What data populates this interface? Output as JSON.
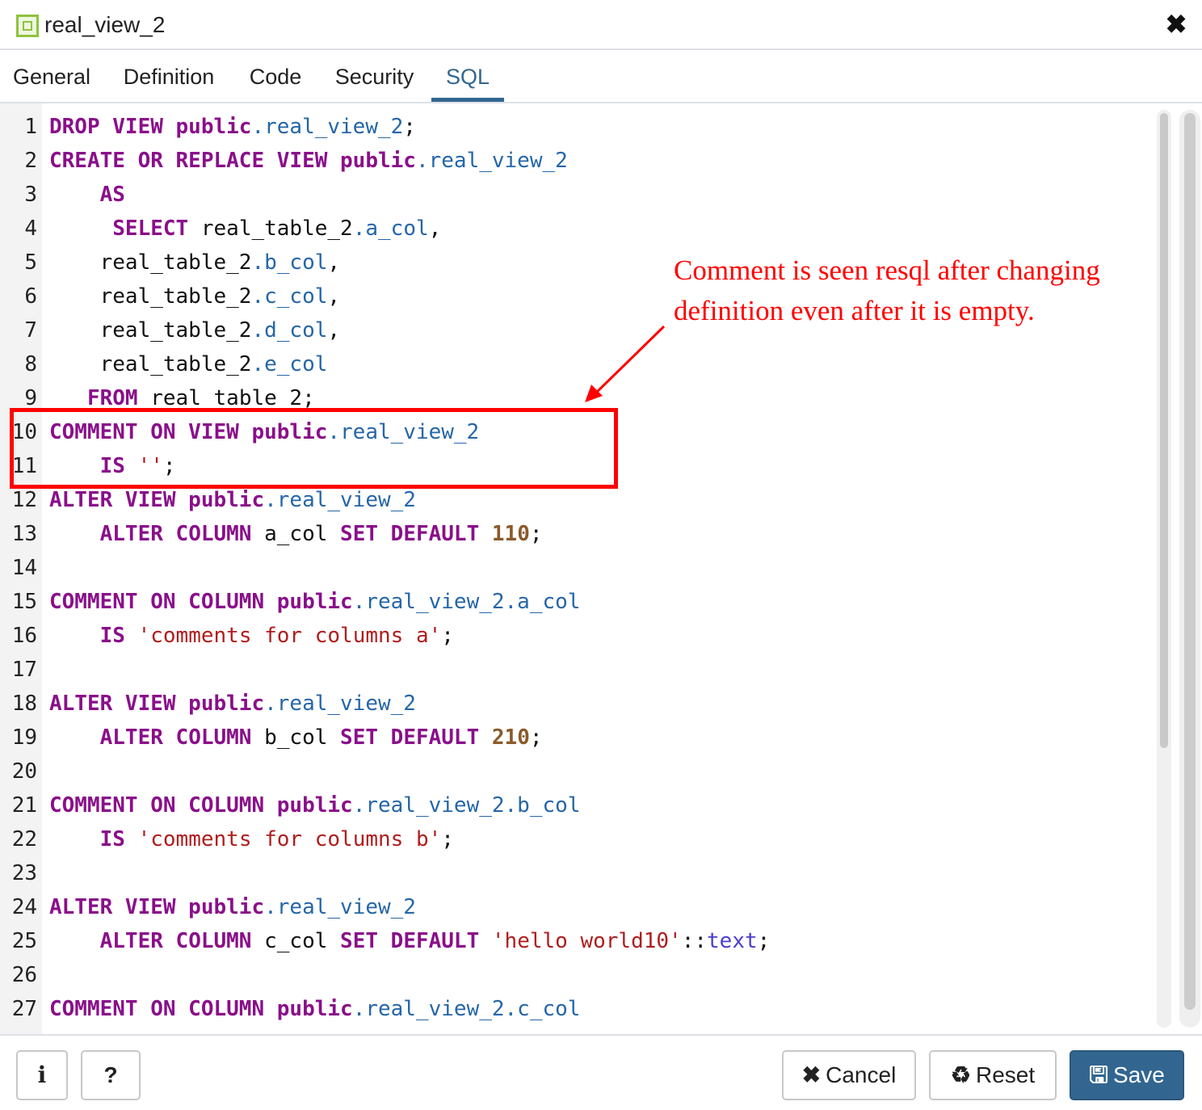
{
  "dialog": {
    "title": "real_view_2",
    "icon": "view-icon",
    "close_glyph": "✖"
  },
  "tabs": [
    {
      "label": "General",
      "active": false
    },
    {
      "label": "Definition",
      "active": false
    },
    {
      "label": "Code",
      "active": false
    },
    {
      "label": "Security",
      "active": false
    },
    {
      "label": "SQL",
      "active": true
    }
  ],
  "sql_lines": [
    {
      "n": "1",
      "tokens": [
        [
          "kw",
          "DROP VIEW public"
        ],
        [
          "id",
          ".real_view_2"
        ],
        [
          "p",
          ";"
        ]
      ]
    },
    {
      "n": "2",
      "tokens": [
        [
          "kw",
          "CREATE OR REPLACE VIEW public"
        ],
        [
          "id",
          ".real_view_2"
        ]
      ]
    },
    {
      "n": "3",
      "tokens": [
        [
          "p",
          "    "
        ],
        [
          "kw",
          "AS"
        ]
      ]
    },
    {
      "n": "4",
      "tokens": [
        [
          "p",
          "     "
        ],
        [
          "kw",
          "SELECT"
        ],
        [
          "p",
          " real_table_2"
        ],
        [
          "id",
          ".a_col"
        ],
        [
          "p",
          ","
        ]
      ]
    },
    {
      "n": "5",
      "tokens": [
        [
          "p",
          "    real_table_2"
        ],
        [
          "id",
          ".b_col"
        ],
        [
          "p",
          ","
        ]
      ]
    },
    {
      "n": "6",
      "tokens": [
        [
          "p",
          "    real_table_2"
        ],
        [
          "id",
          ".c_col"
        ],
        [
          "p",
          ","
        ]
      ]
    },
    {
      "n": "7",
      "tokens": [
        [
          "p",
          "    real_table_2"
        ],
        [
          "id",
          ".d_col"
        ],
        [
          "p",
          ","
        ]
      ]
    },
    {
      "n": "8",
      "tokens": [
        [
          "p",
          "    real_table_2"
        ],
        [
          "id",
          ".e_col"
        ]
      ]
    },
    {
      "n": "9",
      "tokens": [
        [
          "p",
          "   "
        ],
        [
          "kw",
          "FROM"
        ],
        [
          "p",
          " real_table_2;"
        ]
      ]
    },
    {
      "n": "10",
      "tokens": [
        [
          "kw",
          "COMMENT ON VIEW public"
        ],
        [
          "id",
          ".real_view_2"
        ]
      ]
    },
    {
      "n": "11",
      "tokens": [
        [
          "p",
          "    "
        ],
        [
          "kw",
          "IS"
        ],
        [
          "p",
          " "
        ],
        [
          "str",
          "''"
        ],
        [
          "p",
          ";"
        ]
      ]
    },
    {
      "n": "12",
      "tokens": [
        [
          "kw",
          "ALTER VIEW public"
        ],
        [
          "id",
          ".real_view_2"
        ]
      ]
    },
    {
      "n": "13",
      "tokens": [
        [
          "p",
          "    "
        ],
        [
          "kw",
          "ALTER COLUMN"
        ],
        [
          "p",
          " a_col "
        ],
        [
          "kw",
          "SET DEFAULT"
        ],
        [
          "p",
          " "
        ],
        [
          "num",
          "110"
        ],
        [
          "p",
          ";"
        ]
      ]
    },
    {
      "n": "14",
      "tokens": []
    },
    {
      "n": "15",
      "tokens": [
        [
          "kw",
          "COMMENT ON COLUMN public"
        ],
        [
          "id",
          ".real_view_2.a_col"
        ]
      ]
    },
    {
      "n": "16",
      "tokens": [
        [
          "p",
          "    "
        ],
        [
          "kw",
          "IS"
        ],
        [
          "p",
          " "
        ],
        [
          "str",
          "'comments for columns a'"
        ],
        [
          "p",
          ";"
        ]
      ]
    },
    {
      "n": "17",
      "tokens": []
    },
    {
      "n": "18",
      "tokens": [
        [
          "kw",
          "ALTER VIEW public"
        ],
        [
          "id",
          ".real_view_2"
        ]
      ]
    },
    {
      "n": "19",
      "tokens": [
        [
          "p",
          "    "
        ],
        [
          "kw",
          "ALTER COLUMN"
        ],
        [
          "p",
          " b_col "
        ],
        [
          "kw",
          "SET DEFAULT"
        ],
        [
          "p",
          " "
        ],
        [
          "num",
          "210"
        ],
        [
          "p",
          ";"
        ]
      ]
    },
    {
      "n": "20",
      "tokens": []
    },
    {
      "n": "21",
      "tokens": [
        [
          "kw",
          "COMMENT ON COLUMN public"
        ],
        [
          "id",
          ".real_view_2.b_col"
        ]
      ]
    },
    {
      "n": "22",
      "tokens": [
        [
          "p",
          "    "
        ],
        [
          "kw",
          "IS"
        ],
        [
          "p",
          " "
        ],
        [
          "str",
          "'comments for columns b'"
        ],
        [
          "p",
          ";"
        ]
      ]
    },
    {
      "n": "23",
      "tokens": []
    },
    {
      "n": "24",
      "tokens": [
        [
          "kw",
          "ALTER VIEW public"
        ],
        [
          "id",
          ".real_view_2"
        ]
      ]
    },
    {
      "n": "25",
      "tokens": [
        [
          "p",
          "    "
        ],
        [
          "kw",
          "ALTER COLUMN"
        ],
        [
          "p",
          " c_col "
        ],
        [
          "kw",
          "SET DEFAULT"
        ],
        [
          "p",
          " "
        ],
        [
          "str",
          "'hello world10'"
        ],
        [
          "p",
          "::"
        ],
        [
          "typ",
          "text"
        ],
        [
          "p",
          ";"
        ]
      ]
    },
    {
      "n": "26",
      "tokens": []
    },
    {
      "n": "27",
      "tokens": [
        [
          "kw",
          "COMMENT ON COLUMN public"
        ],
        [
          "id",
          ".real_view_2.c_col"
        ]
      ]
    }
  ],
  "annotation": {
    "text": "Comment is seen resql after changing definition even after it is empty.",
    "color": "#ff0000"
  },
  "footer": {
    "info_label": "i",
    "help_label": "?",
    "cancel_label": "Cancel",
    "reset_label": "Reset",
    "save_label": "Save"
  },
  "colors": {
    "keyword": "#8a0f8a",
    "identifier": "#2566a8",
    "string": "#b01d1d",
    "number": "#8b5a2b",
    "accent": "#326690"
  }
}
